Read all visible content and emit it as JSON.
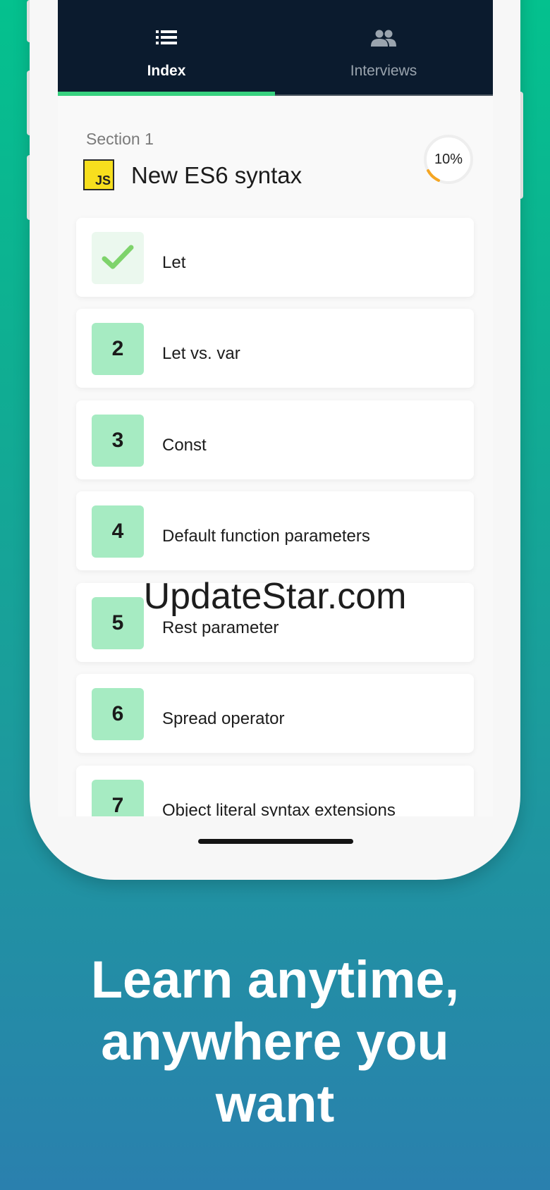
{
  "tabs": [
    {
      "label": "Index",
      "icon": "list-icon",
      "active": true
    },
    {
      "label": "Interviews",
      "icon": "people-icon",
      "active": false
    }
  ],
  "section": {
    "label": "Section 1",
    "title": "New ES6 syntax",
    "logo_text": "JS",
    "progress": "10%",
    "progress_fraction": 0.1
  },
  "items": [
    {
      "badge": "",
      "label": "Let",
      "done": true
    },
    {
      "badge": "2",
      "label": "Let vs. var",
      "done": false
    },
    {
      "badge": "3",
      "label": "Const",
      "done": false
    },
    {
      "badge": "4",
      "label": "Default function parameters",
      "done": false
    },
    {
      "badge": "5",
      "label": "Rest parameter",
      "done": false
    },
    {
      "badge": "6",
      "label": "Spread operator",
      "done": false
    },
    {
      "badge": "7",
      "label": "Object literal syntax extensions",
      "done": false
    }
  ],
  "watermark": "UpdateStar.com",
  "tagline": {
    "line1": "Learn anytime,",
    "line2": "anywhere you",
    "line3": "want"
  },
  "colors": {
    "accent": "#38d17f",
    "tabbar": "#0b1b2e",
    "badge": "#a6ebc2",
    "progress": "#f5a623"
  }
}
